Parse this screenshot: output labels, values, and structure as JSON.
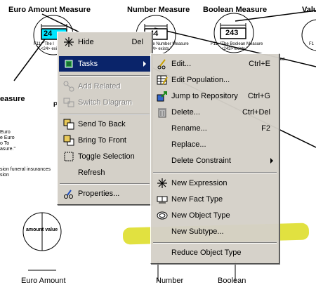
{
  "diagram": {
    "headers": [
      "Euro Amount Measure",
      "Number Measure",
      "Boolean Measure",
      "Valu"
    ],
    "value_boxes": [
      "24",
      "44",
      "243"
    ],
    "captions": {
      "euro": [
        "F11:  \"The l",
        "<24> exi"
      ],
      "number": [
        "F11:  \"The Number Measure",
        "<44> exists.\""
      ],
      "boolean": [
        "F11:  \"The Boolean Measure",
        "<243> exists.\""
      ],
      "right": [
        "F1"
      ],
      "right2": "ted"
    },
    "left_labels": {
      "measure": "easure",
      "p": "P",
      "lines": [
        "Euro",
        "e Euro",
        "o To",
        "asure.\""
      ],
      "lines2": [
        "sion funeral insurances",
        "sion"
      ]
    },
    "amount_value": "amount value",
    "bottom_labels": [
      "Euro Amount",
      "Number",
      "Boolean"
    ]
  },
  "context_menu": {
    "items": [
      {
        "label": "Hide",
        "shortcut": "Del",
        "icon": "hide-icon",
        "state": "normal"
      },
      {
        "label": "Tasks",
        "icon": "tasks-icon",
        "state": "selected",
        "submenu": true
      },
      {
        "label": "Add Related",
        "icon": "add-related-icon",
        "state": "disabled"
      },
      {
        "label": "Switch Diagram",
        "icon": "switch-diagram-icon",
        "state": "disabled"
      },
      {
        "label": "Send To Back",
        "icon": "send-to-back-icon",
        "state": "normal"
      },
      {
        "label": "Bring To Front",
        "icon": "bring-to-front-icon",
        "state": "normal"
      },
      {
        "label": "Toggle Selection",
        "icon": "toggle-selection-icon",
        "state": "normal"
      },
      {
        "label": "Refresh",
        "icon": "",
        "state": "normal"
      },
      {
        "label": "Properties...",
        "icon": "properties-icon",
        "state": "normal"
      }
    ]
  },
  "tasks_submenu": {
    "items": [
      {
        "label": "Edit...",
        "shortcut": "Ctrl+E",
        "icon": "edit-icon"
      },
      {
        "label": "Edit Population...",
        "shortcut": "",
        "icon": "edit-population-icon"
      },
      {
        "label": "Jump to Repository",
        "shortcut": "Ctrl+G",
        "icon": "jump-to-repository-icon"
      },
      {
        "label": "Delete...",
        "shortcut": "Ctrl+Del",
        "icon": "trash-icon"
      },
      {
        "label": "Rename...",
        "shortcut": "F2",
        "icon": ""
      },
      {
        "label": "Replace...",
        "shortcut": "",
        "icon": ""
      },
      {
        "label": "Delete Constraint",
        "shortcut": "",
        "icon": "",
        "submenu": true
      },
      {
        "label": "New Expression",
        "shortcut": "",
        "icon": "new-expression-icon"
      },
      {
        "label": "New Fact Type",
        "shortcut": "",
        "icon": "new-fact-type-icon"
      },
      {
        "label": "New Object Type",
        "shortcut": "",
        "icon": "new-object-type-icon"
      },
      {
        "label": "New Subtype...",
        "shortcut": "",
        "icon": "",
        "highlighted": true
      },
      {
        "label": "Reduce Object Type",
        "shortcut": "",
        "icon": ""
      }
    ]
  },
  "colors": {
    "menu_bg": "#d4d0c8",
    "selection": "#0a246a",
    "highlighter": "#dcdc1e",
    "value_box_selected": "#00e5ff"
  }
}
